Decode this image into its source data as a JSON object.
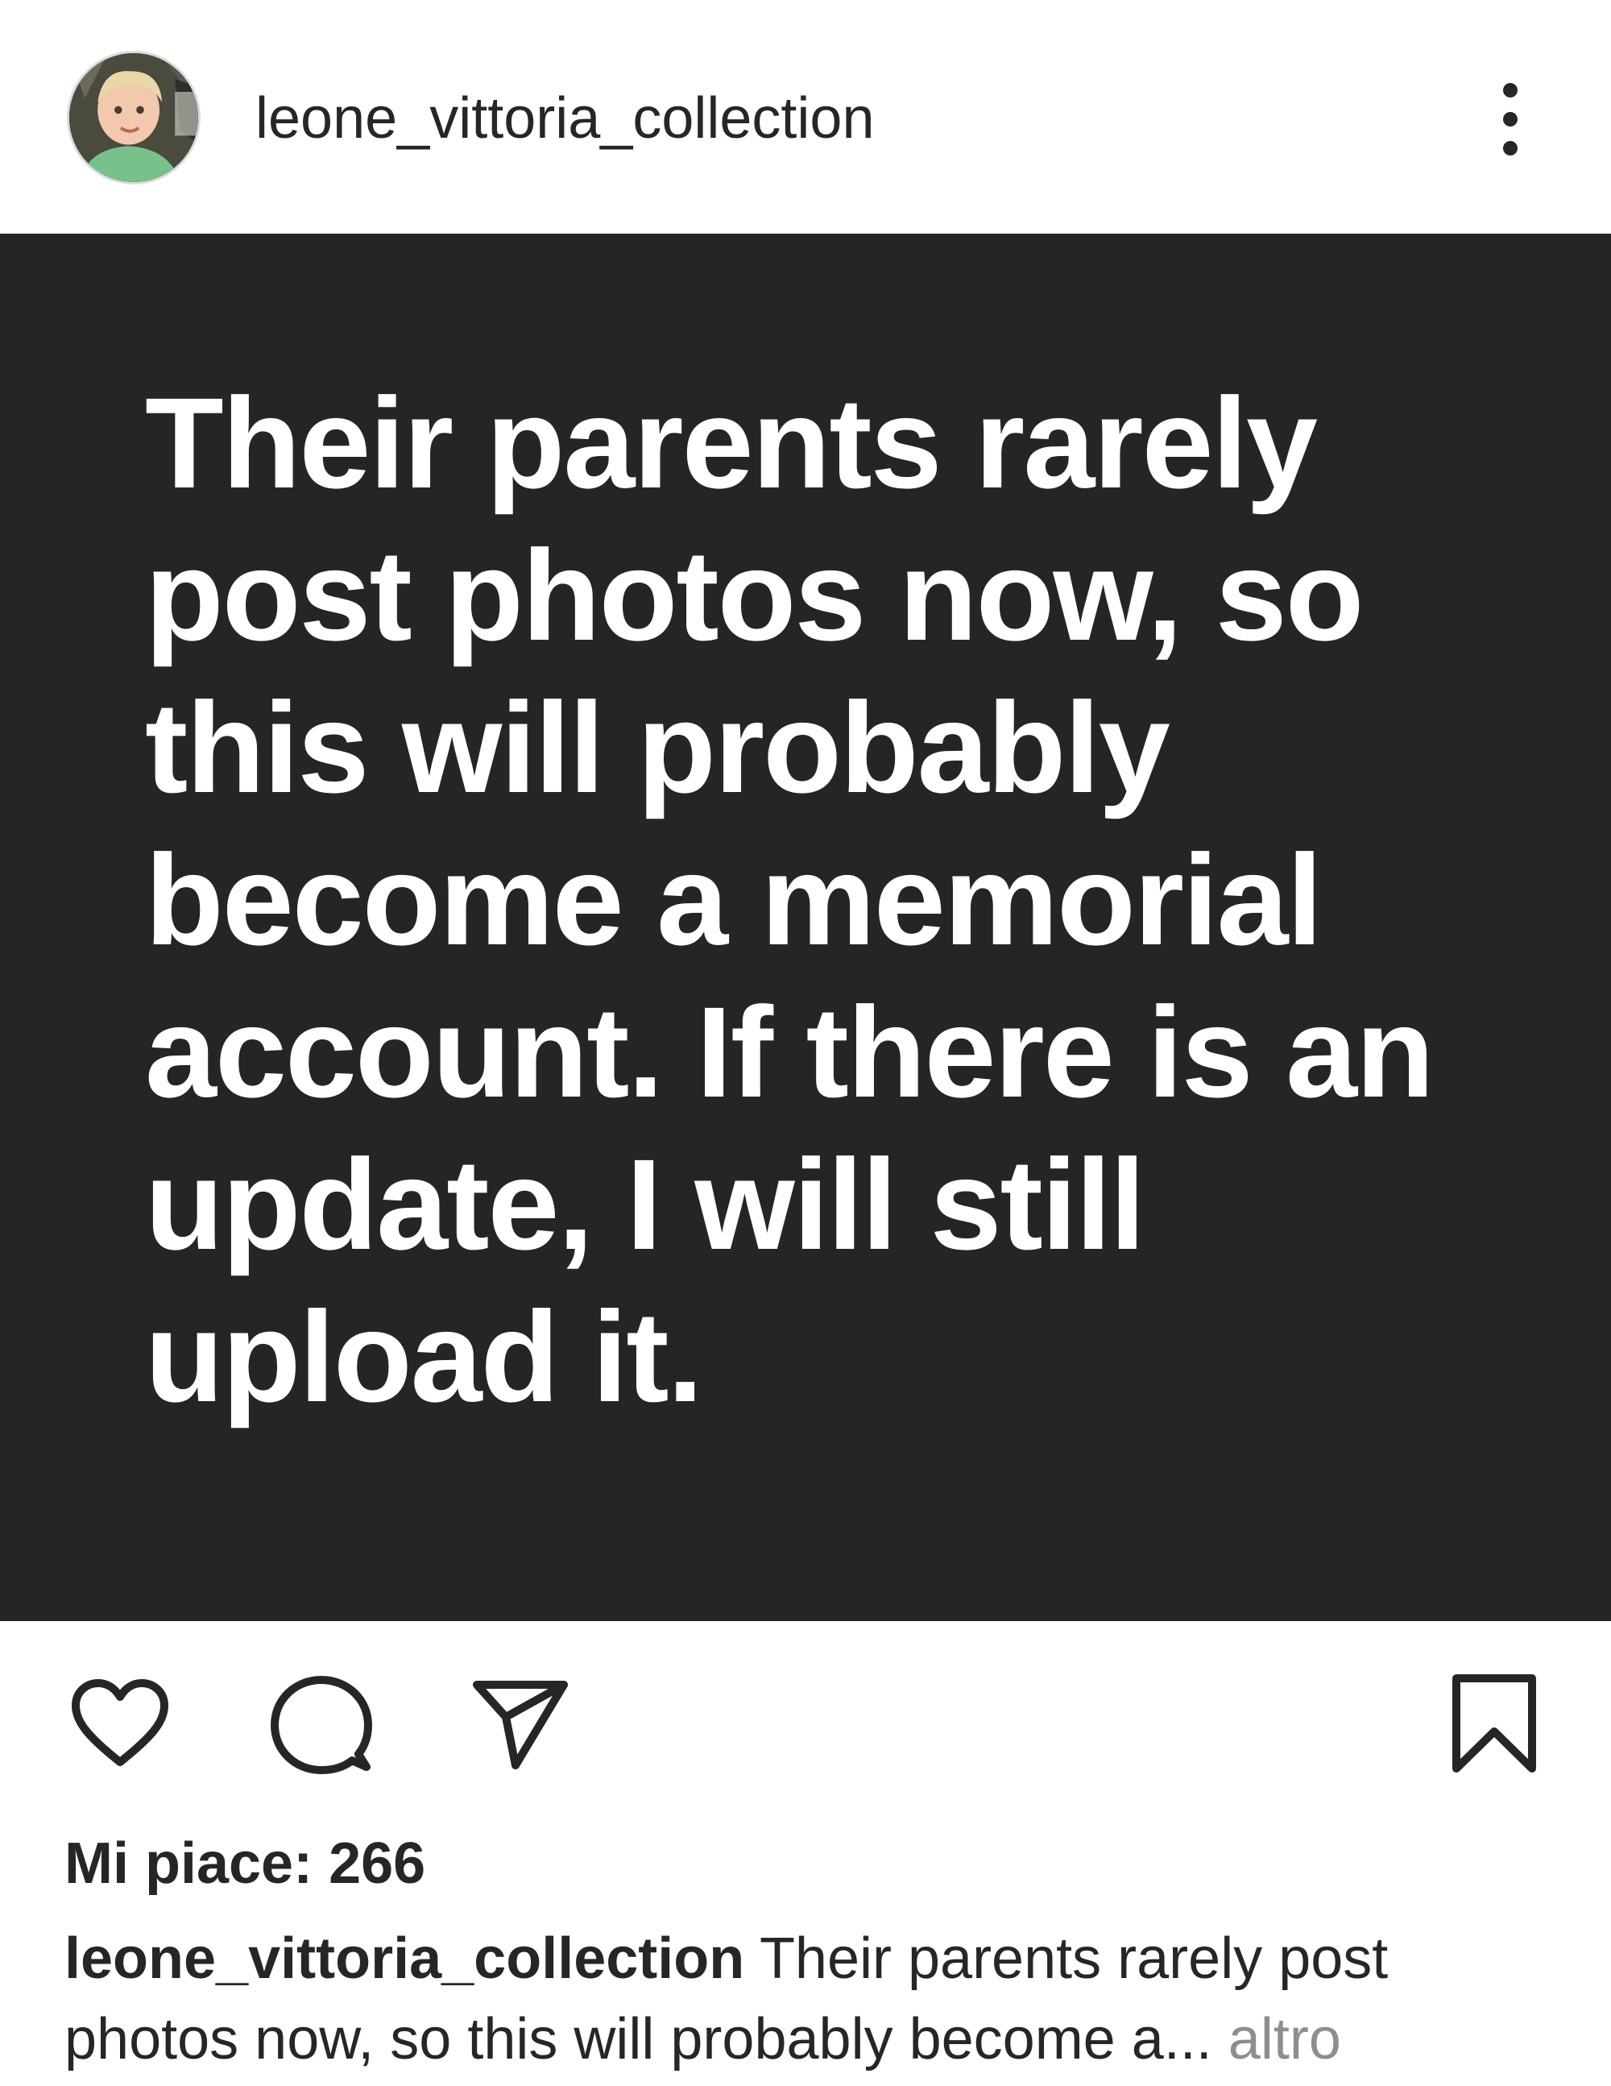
{
  "post": {
    "username": "leone_vittoria_collection",
    "image_text": "Their parents rarely\npost photos now, so\nthis will probably\nbecome a memorial\naccount. If there is an\nupdate, I will still\nupload it.",
    "likes_text": "Mi piace: 266",
    "caption": {
      "username": "leone_vittoria_collection",
      "text_line1": "Their parents rarely post",
      "text_line2": "photos now, so this will probably become a...",
      "more_label": "altro"
    }
  },
  "icons": {
    "avatar": "child-avatar",
    "more": "more-vertical-icon",
    "like": "heart-icon",
    "comment": "comment-icon",
    "share": "send-icon",
    "save": "bookmark-icon"
  },
  "colors": {
    "post_background": "#252525",
    "post_text": "#ffffff",
    "text": "#262626",
    "muted": "#8e8e8e"
  }
}
